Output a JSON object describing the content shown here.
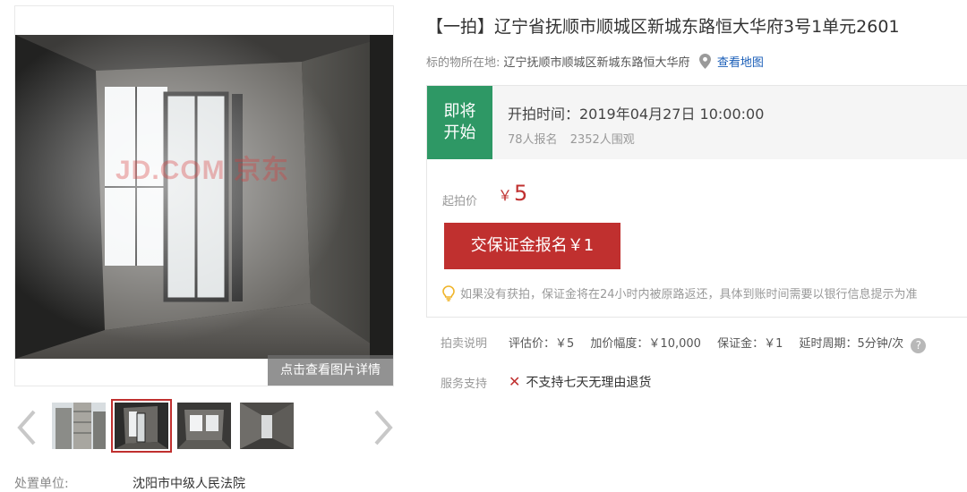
{
  "title": "【一拍】辽宁省抚顺市顺城区新城东路恒大华府3号1单元2601",
  "location": {
    "label": "标的物所在地:",
    "address": "辽宁抚顺市顺城区新城东路恒大华府",
    "map_link": "查看地图"
  },
  "status": {
    "badge_line1": "即将",
    "badge_line2": "开始",
    "start_time": "开拍时间：2019年04月27日 10:00:00",
    "registrations": "78人报名",
    "watchers": "2352人围观",
    "badge_color": "#2e9865"
  },
  "price": {
    "label": "起拍价",
    "currency": "￥",
    "value": "5"
  },
  "deposit_button": "交保证金报名￥1",
  "notice": "如果没有获拍，保证金将在24小时内被原路返还，具体到账时间需要以银行信息提示为准",
  "rules": {
    "label": "拍卖说明",
    "appraisal": "评估价：￥5",
    "increment": "加价幅度：￥10,000",
    "deposit": "保证金：￥1",
    "delay": "延时周期：5分钟/次"
  },
  "service": {
    "label": "服务支持",
    "text": "不支持七天无理由退货"
  },
  "gallery": {
    "watermark": "JD.COM 京东",
    "detail_button": "点击查看图片详情",
    "thumbnails": [
      "exterior",
      "room-window-selected",
      "room-window",
      "corridor"
    ],
    "selected_index": 1
  },
  "handler": {
    "label": "处置单位:",
    "value": "沈阳市中级人民法院"
  },
  "colors": {
    "accent_red": "#c0302f",
    "link_blue": "#1a5eb8",
    "status_green": "#2e9865"
  }
}
